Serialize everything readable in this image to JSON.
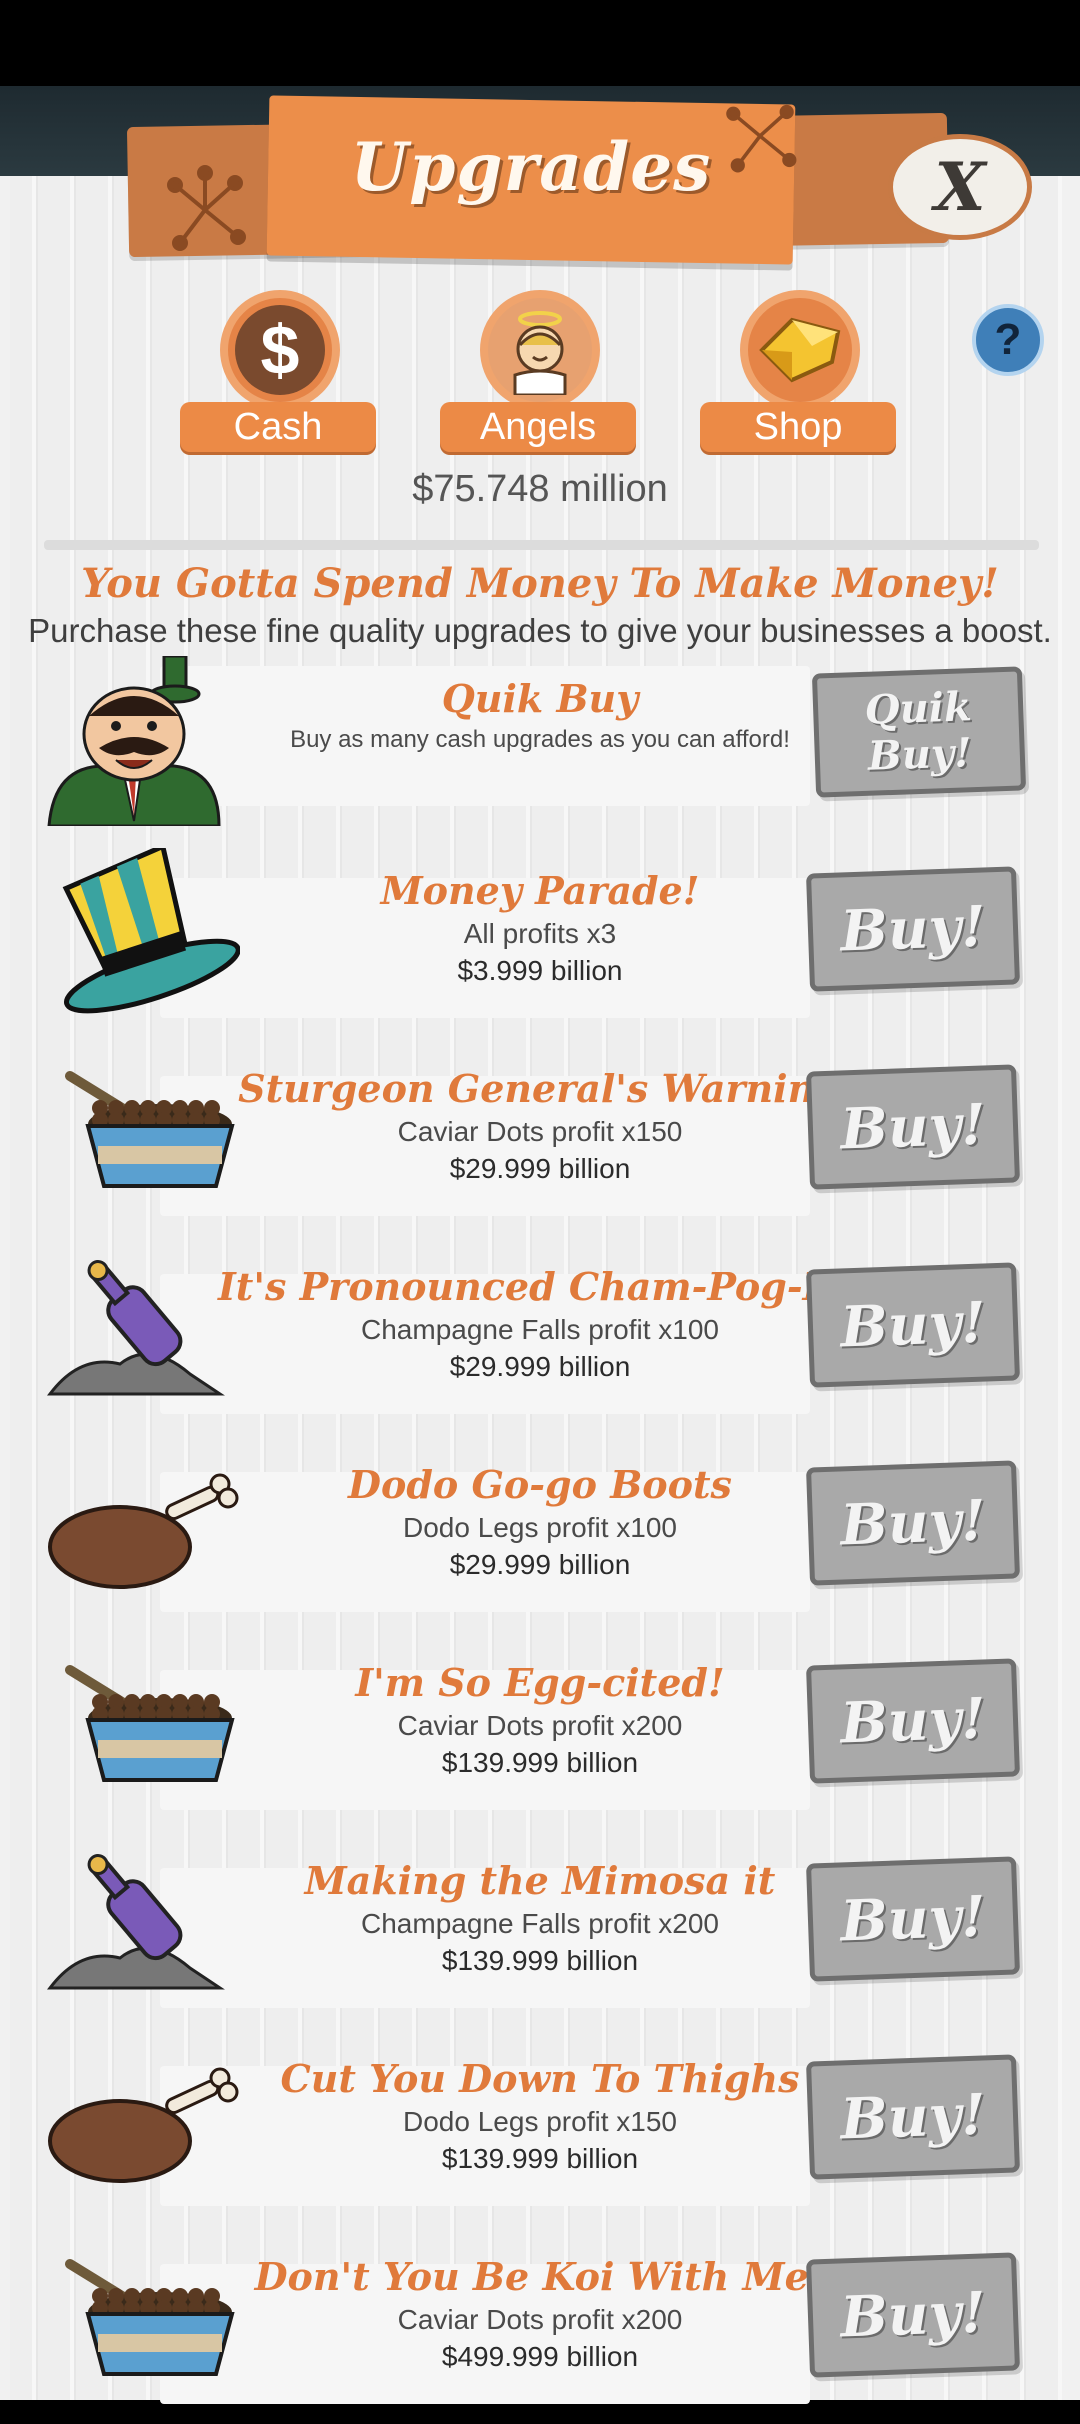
{
  "header": {
    "title": "Upgrades",
    "close_label": "X",
    "help_label": "?"
  },
  "tabs": [
    {
      "label": "Cash",
      "icon": "cash-icon"
    },
    {
      "label": "Angels",
      "icon": "angel-icon"
    },
    {
      "label": "Shop",
      "icon": "gold-icon"
    }
  ],
  "balance": "$75.748 million",
  "intro": {
    "headline": "You Gotta Spend Money To Make Money!",
    "subline": "Purchase these fine quality upgrades to give your businesses a boost."
  },
  "quik_buy": {
    "name": "Quik Buy",
    "desc": "Buy as many cash upgrades as you can afford!",
    "button": "Quik Buy!"
  },
  "buy_label": "Buy!",
  "upgrades": [
    {
      "name": "Money Parade!",
      "desc": "All profits x3",
      "price": "$3.999 billion",
      "icon": "hat-icon"
    },
    {
      "name": "Sturgeon General's Warning",
      "desc": "Caviar Dots profit x150",
      "price": "$29.999 billion",
      "icon": "caviar-bowl-icon"
    },
    {
      "name": "It's Pronounced Cham-Pog-Na",
      "desc": "Champagne Falls profit x100",
      "price": "$29.999 billion",
      "icon": "champagne-bottle-icon"
    },
    {
      "name": "Dodo Go-go Boots",
      "desc": "Dodo Legs profit x100",
      "price": "$29.999 billion",
      "icon": "drumstick-icon"
    },
    {
      "name": "I'm So Egg-cited!",
      "desc": "Caviar Dots profit x200",
      "price": "$139.999 billion",
      "icon": "caviar-bowl-icon"
    },
    {
      "name": "Making the Mimosa it",
      "desc": "Champagne Falls profit x200",
      "price": "$139.999 billion",
      "icon": "champagne-bottle-icon"
    },
    {
      "name": "Cut You Down To Thighs",
      "desc": "Dodo Legs profit x150",
      "price": "$139.999 billion",
      "icon": "drumstick-icon"
    },
    {
      "name": "Don't You Be Koi With Me!",
      "desc": "Caviar Dots profit x200",
      "price": "$499.999 billion",
      "icon": "caviar-bowl-icon"
    }
  ],
  "colors": {
    "accent": "#e07a3b",
    "banner": "#ec8e4a",
    "button_gray": "#a9a9a9"
  }
}
